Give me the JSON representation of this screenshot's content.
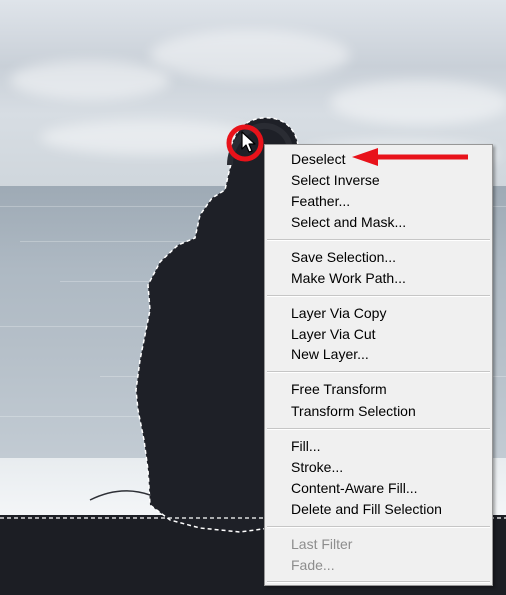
{
  "context_menu": {
    "groups": [
      {
        "items": [
          {
            "label": "Deselect"
          },
          {
            "label": "Select Inverse"
          },
          {
            "label": "Feather..."
          },
          {
            "label": "Select and Mask..."
          }
        ]
      },
      {
        "items": [
          {
            "label": "Save Selection..."
          },
          {
            "label": "Make Work Path..."
          }
        ]
      },
      {
        "items": [
          {
            "label": "Layer Via Copy"
          },
          {
            "label": "Layer Via Cut"
          },
          {
            "label": "New Layer..."
          }
        ]
      },
      {
        "items": [
          {
            "label": "Free Transform"
          },
          {
            "label": "Transform Selection"
          }
        ]
      },
      {
        "items": [
          {
            "label": "Fill..."
          },
          {
            "label": "Stroke..."
          },
          {
            "label": "Content-Aware Fill..."
          },
          {
            "label": "Delete and Fill Selection"
          }
        ]
      },
      {
        "items": [
          {
            "label": "Last Filter",
            "disabled": true
          },
          {
            "label": "Fade...",
            "disabled": true
          }
        ]
      }
    ]
  },
  "annotation": {
    "arrow_color": "#e8121a",
    "highlight_ring_color": "#e8121a"
  },
  "colors": {
    "menu_bg": "#f0f0f0",
    "menu_text": "#000000",
    "menu_disabled_text": "#8d8d8d"
  }
}
